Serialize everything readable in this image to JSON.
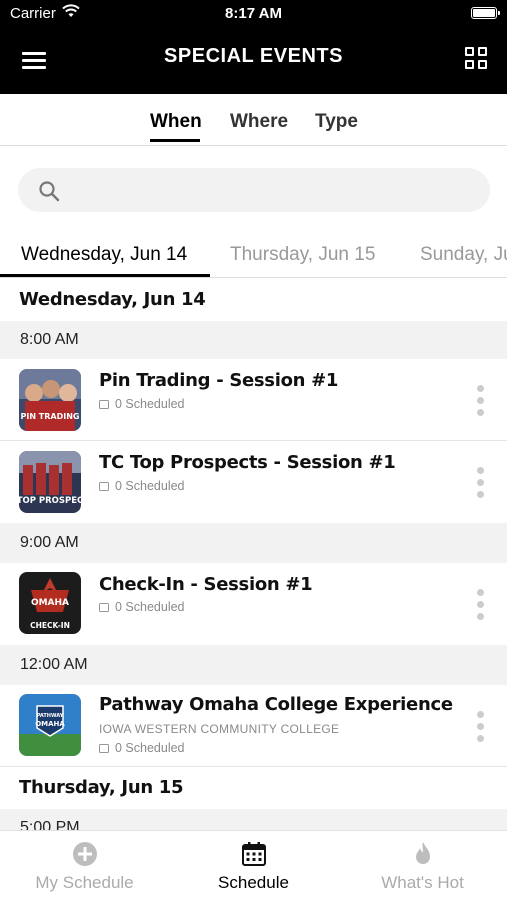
{
  "status": {
    "carrier": "Carrier",
    "time": "8:17 AM"
  },
  "header": {
    "title": "SPECIAL EVENTS"
  },
  "filter_tabs": [
    "When",
    "Where",
    "Type"
  ],
  "search": {
    "placeholder": ""
  },
  "date_tabs": [
    "Wednesday, Jun 14",
    "Thursday, Jun 15",
    "Sunday, Ju"
  ],
  "sections": [
    {
      "day": "Wednesday, Jun 14"
    },
    {
      "day": "Thursday, Jun 15"
    }
  ],
  "times": [
    "8:00 AM",
    "9:00 AM",
    "12:00 AM",
    "5:00 PM"
  ],
  "events": [
    {
      "title": "Pin Trading - Session #1",
      "scheduled": "0 Scheduled",
      "thumb_text": "PIN TRADING"
    },
    {
      "title": "TC Top Prospects - Session #1",
      "scheduled": "0 Scheduled",
      "thumb_text": "TOP PROSPEC"
    },
    {
      "title": "Check-In - Session #1",
      "scheduled": "0 Scheduled",
      "thumb_text_top": "OMAHA",
      "thumb_text_bottom": "CHECK-IN"
    },
    {
      "title": "Pathway Omaha College Experience",
      "location": "IOWA WESTERN COMMUNITY COLLEGE",
      "scheduled": "0 Scheduled",
      "thumb_text_top": "PATHWAY",
      "thumb_text_bottom": "OMAHA"
    }
  ],
  "bottom_nav": [
    {
      "label": "My Schedule",
      "icon": "plus-circle-icon",
      "active": false
    },
    {
      "label": "Schedule",
      "icon": "calendar-icon",
      "active": true
    },
    {
      "label": "What's Hot",
      "icon": "flame-icon",
      "active": false
    }
  ],
  "colors": {
    "header_bg": "#000000",
    "accent": "#000000",
    "muted": "#999999",
    "row_bg": "#f2f2f2"
  }
}
